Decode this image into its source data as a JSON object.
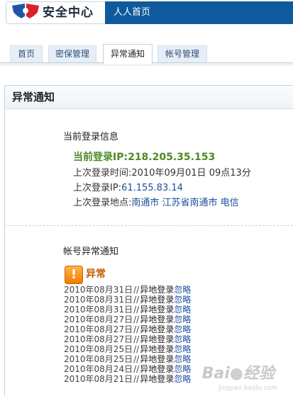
{
  "header": {
    "logo_title": "安全中心",
    "site_name": "人人首页",
    "brand_colors": {
      "shield_left": "#1c56a7",
      "shield_right": "#d8232a",
      "bar": "#0f5a9c"
    }
  },
  "tabs": [
    {
      "label": "首页",
      "active": false
    },
    {
      "label": "密保管理",
      "active": false
    },
    {
      "label": "异常通知",
      "active": true
    },
    {
      "label": "帐号管理",
      "active": false
    }
  ],
  "panel": {
    "title": "异常通知",
    "current_login": {
      "section_title": "当前登录信息",
      "current_ip_label": "当前登录IP:",
      "current_ip": "218.205.35.153",
      "last_time_label": "上次登录时间:",
      "last_time": "2010年09月01日 09点13分",
      "last_ip_label": "上次登录IP:",
      "last_ip": "61.155.83.14",
      "last_location_label": "上次登录地点:",
      "last_location": "南通市 江苏省南通市 电信"
    },
    "account_alerts": {
      "section_title": "帐号异常通知",
      "warning_icon": "!",
      "warning_label": "异常",
      "separator": "//",
      "event_text": "异地登录",
      "ignore_label": "忽略",
      "items": [
        {
          "date": "2010年08月31日"
        },
        {
          "date": "2010年08月31日"
        },
        {
          "date": "2010年08月31日"
        },
        {
          "date": "2010年08月27日"
        },
        {
          "date": "2010年08月27日"
        },
        {
          "date": "2010年08月27日"
        },
        {
          "date": "2010年08月25日"
        },
        {
          "date": "2010年08月25日"
        },
        {
          "date": "2010年08月24日"
        },
        {
          "date": "2010年08月21日"
        }
      ]
    }
  },
  "watermark": {
    "text": "Bai du 经验",
    "sub": "jingyan.baidu.com"
  }
}
